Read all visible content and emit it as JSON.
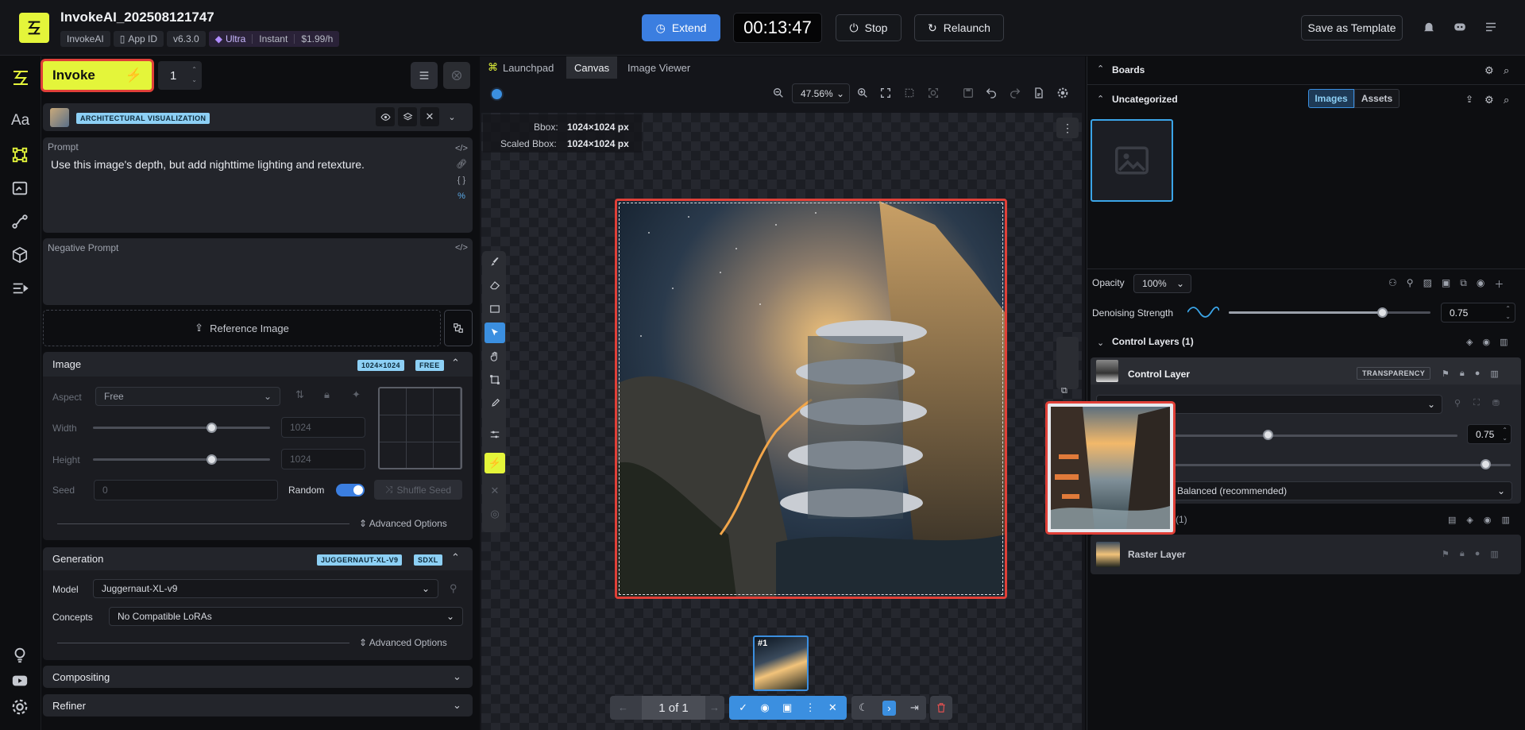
{
  "header": {
    "title": "InvokeAI_202508121747",
    "chips": {
      "org": "InvokeAI",
      "appid": "App ID",
      "version": "v6.3.0",
      "plan": "Ultra",
      "plan_mode": "Instant",
      "price": "$1.99/h"
    },
    "extend": "Extend",
    "timer": "00:13:47",
    "stop": "Stop",
    "relaunch": "Relaunch",
    "save_template": "Save as Template"
  },
  "left": {
    "invoke": "Invoke",
    "quantity": "1",
    "style_tag": "ARCHITECTURAL VISUALIZATION",
    "prompt_label": "Prompt",
    "prompt_text": "Use this image's depth, but add nighttime lighting and retexture.",
    "negative_label": "Negative Prompt",
    "reference": "Reference Image",
    "image": {
      "title": "Image",
      "tag_size": "1024×1024",
      "tag_free": "FREE",
      "aspect_label": "Aspect",
      "aspect_value": "Free",
      "width_label": "Width",
      "width_value": "1024",
      "width_pct": 0.67,
      "height_label": "Height",
      "height_value": "1024",
      "height_pct": 0.67,
      "seed_label": "Seed",
      "seed_value": "0",
      "random_label": "Random",
      "shuffle": "Shuffle Seed",
      "advanced": "Advanced Options"
    },
    "generation": {
      "title": "Generation",
      "tag_model": "JUGGERNAUT-XL-V9",
      "tag_base": "SDXL",
      "model_label": "Model",
      "model_value": "Juggernaut-XL-v9",
      "concepts_label": "Concepts",
      "concepts_value": "No Compatible LoRAs",
      "advanced": "Advanced Options"
    },
    "compositing": "Compositing",
    "refiner": "Refiner"
  },
  "canvas": {
    "tabs": [
      "Launchpad",
      "Canvas",
      "Image Viewer"
    ],
    "zoom": "47.56%",
    "bbox_label": "Bbox:",
    "bbox_value": "1024×1024 px",
    "scaled_label": "Scaled Bbox:",
    "scaled_value": "1024×1024 px",
    "thumb_label": "#1",
    "pager": "1 of 1"
  },
  "right": {
    "boards": "Boards",
    "uncategorized": "Uncategorized",
    "images_tab": "Images",
    "assets_tab": "Assets",
    "opacity_label": "Opacity",
    "opacity_value": "100%",
    "denoise_label": "Denoising Strength",
    "denoise_value": "0.75",
    "denoise_pct": 0.76,
    "control_layers": "Control Layers (1)",
    "control_layer": "Control Layer",
    "transparency": "TRANSPARENCY",
    "weight_value": "0.75",
    "weight_pct": 0.38,
    "end_pct": 0.93,
    "mode_value": "Balanced (recommended)",
    "raster_count": "(1)",
    "raster_layer": "Raster Layer"
  },
  "colors": {
    "accent": "#e4f53a",
    "blue": "#3b7ee0",
    "highlight": "#e04038"
  }
}
